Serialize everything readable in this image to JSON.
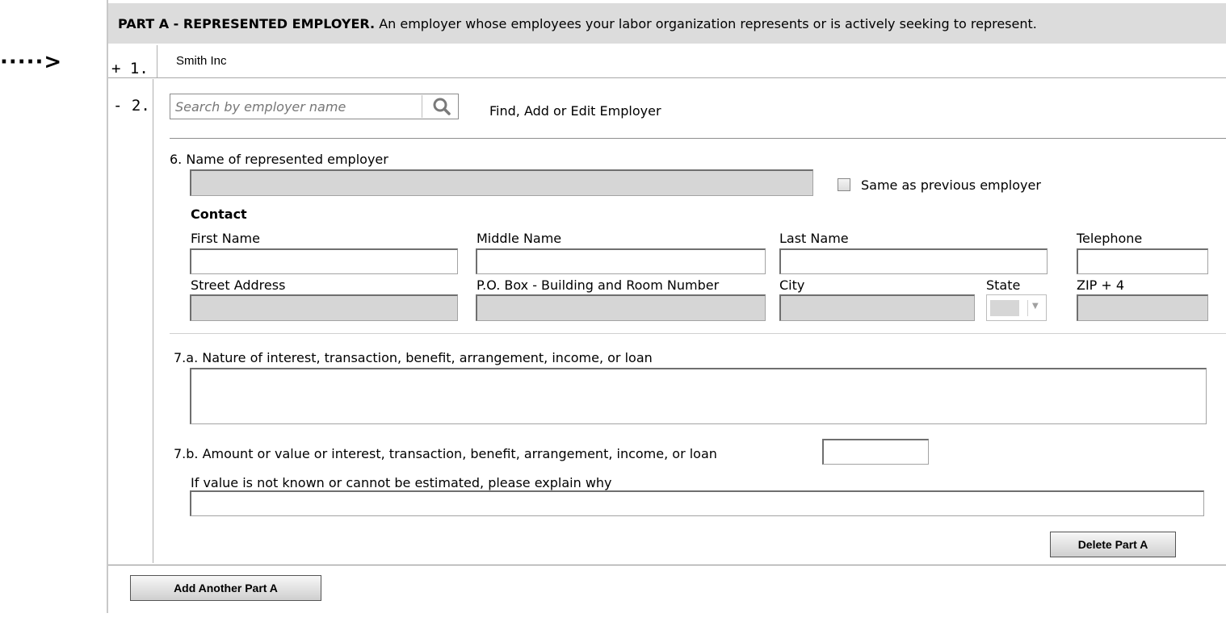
{
  "header": {
    "title_bold": "PART A - REPRESENTED EMPLOYER.",
    "title_rest": " An employer whose employees your labor organization represents or is actively seeking to represent."
  },
  "pointer": {
    "dots": "·····>"
  },
  "rows": [
    {
      "toggle": "+",
      "number": "1.",
      "employer_name": "Smith Inc"
    },
    {
      "toggle": "-",
      "number": "2."
    }
  ],
  "search": {
    "placeholder": "Search by employer name",
    "value": "",
    "link_text": "Find, Add or Edit Employer"
  },
  "form": {
    "q6_label": "6. Name of represented employer",
    "q6_value": "",
    "same_as_previous_label": "Same as previous employer",
    "same_as_previous_checked": false,
    "contact_heading": "Contact",
    "first_name_label": "First Name",
    "middle_name_label": "Middle Name",
    "last_name_label": "Last Name",
    "telephone_label": "Telephone",
    "street_label": "Street Address",
    "pobox_label": "P.O. Box - Building and Room Number",
    "city_label": "City",
    "state_label": "State",
    "zip_label": "ZIP + 4",
    "state_value": "",
    "q7a_label": "7.a. Nature of interest, transaction, benefit, arrangement, income, or loan",
    "q7b_label": "7.b. Amount or value or interest, transaction, benefit, arrangement, income, or loan",
    "explain_label": "If value is not known or cannot be estimated, please explain why"
  },
  "buttons": {
    "delete": "Delete Part A",
    "add_another": "Add Another Part A"
  },
  "colors": {
    "header_bg": "#dcdcdc",
    "disabled_field_bg": "#d6d6d6"
  }
}
